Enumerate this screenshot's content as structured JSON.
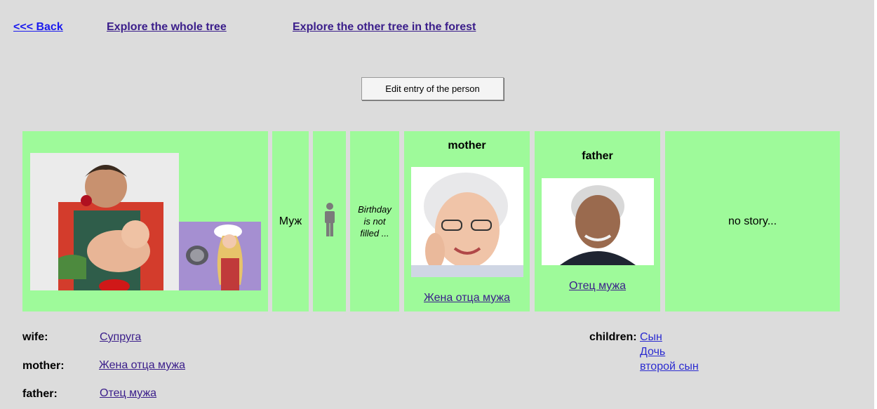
{
  "nav": {
    "back": "<<< Back",
    "whole_tree": "Explore the whole tree",
    "other_tree": "Explore the other tree in the forest"
  },
  "edit_button": "Edit entry of the person",
  "person": {
    "name": "Муж",
    "gender_icon": "male-person-icon",
    "birthday": "Birthday is not filled ...",
    "story": "no story..."
  },
  "mother_card": {
    "title": "mother",
    "link": "Жена отца мужа"
  },
  "father_card": {
    "title": "father",
    "link": "Отец мужа"
  },
  "relations": {
    "wife_label": "wife:",
    "wife_link": "Супруга",
    "mother_label": "mother:",
    "mother_link": "Жена отца мужа",
    "father_label": "father:",
    "father_link": "Отец мужа",
    "children_label": "children:",
    "children": [
      "Сын",
      "Дочь",
      "второй сын"
    ]
  },
  "colors": {
    "card_bg": "#9efa9a",
    "page_bg": "#dcdcdc",
    "link": "#3a1d8a",
    "child_link": "#2b2bd0"
  }
}
